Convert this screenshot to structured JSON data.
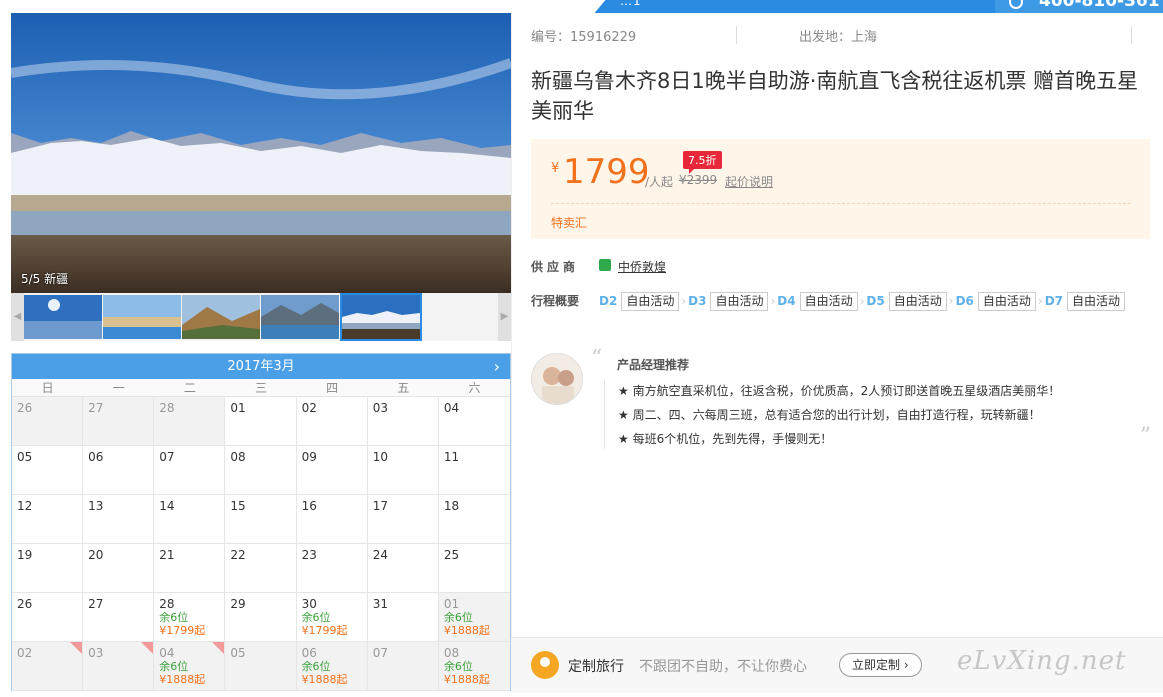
{
  "top_strip": {
    "marquee": "…1",
    "phone": "400-810-361"
  },
  "gallery": {
    "caption": "5/5 新疆",
    "thumb_count": 5
  },
  "calendar": {
    "month": "2017年3月",
    "weekdays": [
      "日",
      "一",
      "二",
      "三",
      "四",
      "五",
      "六"
    ],
    "cells": [
      {
        "day": "26",
        "muted": true
      },
      {
        "day": "27",
        "muted": true
      },
      {
        "day": "28",
        "muted": true
      },
      {
        "day": "01"
      },
      {
        "day": "02"
      },
      {
        "day": "03"
      },
      {
        "day": "04"
      },
      {
        "day": "05"
      },
      {
        "day": "06"
      },
      {
        "day": "07"
      },
      {
        "day": "08"
      },
      {
        "day": "09"
      },
      {
        "day": "10"
      },
      {
        "day": "11"
      },
      {
        "day": "12"
      },
      {
        "day": "13"
      },
      {
        "day": "14"
      },
      {
        "day": "15"
      },
      {
        "day": "16"
      },
      {
        "day": "17"
      },
      {
        "day": "18"
      },
      {
        "day": "19"
      },
      {
        "day": "20"
      },
      {
        "day": "21"
      },
      {
        "day": "22"
      },
      {
        "day": "23"
      },
      {
        "day": "24"
      },
      {
        "day": "25"
      },
      {
        "day": "26"
      },
      {
        "day": "27"
      },
      {
        "day": "28",
        "seats": "余6位",
        "price": "¥1799起"
      },
      {
        "day": "29"
      },
      {
        "day": "30",
        "seats": "余6位",
        "price": "¥1799起"
      },
      {
        "day": "31"
      },
      {
        "day": "01",
        "muted": true,
        "seats": "余6位",
        "price": "¥1888起"
      },
      {
        "day": "02",
        "muted": true,
        "corner": true
      },
      {
        "day": "03",
        "muted": true,
        "corner": true
      },
      {
        "day": "04",
        "muted": true,
        "corner": true,
        "seats": "余6位",
        "price": "¥1888起"
      },
      {
        "day": "05",
        "muted": true
      },
      {
        "day": "06",
        "muted": true,
        "seats": "余6位",
        "price": "¥1888起"
      },
      {
        "day": "07",
        "muted": true
      },
      {
        "day": "08",
        "muted": true,
        "seats": "余6位",
        "price": "¥1888起"
      }
    ]
  },
  "meta": {
    "code": "编号：15916229",
    "depart": "出发地：上海"
  },
  "title": "新疆乌鲁木齐8日1晚半自助游·南航直飞含税往返机票 赠首晚五星美丽华",
  "price": {
    "yen": "¥",
    "amount": "1799",
    "per": "/人起",
    "original": "¥2399",
    "explain": "起价说明",
    "discount": "7.5折",
    "tag": "特卖汇"
  },
  "supplier": {
    "label": "供应商",
    "name": "中侨敦煌"
  },
  "itinerary": {
    "label": "行程概要",
    "days": [
      {
        "d": "D2",
        "act": "自由活动"
      },
      {
        "d": "D3",
        "act": "自由活动"
      },
      {
        "d": "D4",
        "act": "自由活动"
      },
      {
        "d": "D5",
        "act": "自由活动"
      },
      {
        "d": "D6",
        "act": "自由活动"
      },
      {
        "d": "D7",
        "act": "自由活动"
      }
    ]
  },
  "recommend": {
    "title": "产品经理推荐",
    "items": [
      "★ 南方航空直采机位，往返含税，价优质高，2人预订即送首晚五星级酒店美丽华！",
      "★ 周二、四、六每周三班，总有适合您的出行计划，自由打造行程，玩转新疆！",
      "★ 每班6个机位，先到先得，手慢则无！"
    ]
  },
  "custom": {
    "title": "定制旅行",
    "desc": "不跟团不自助，不让你费心",
    "button": "立即定制 ›",
    "watermark": "eLvXing.net"
  }
}
